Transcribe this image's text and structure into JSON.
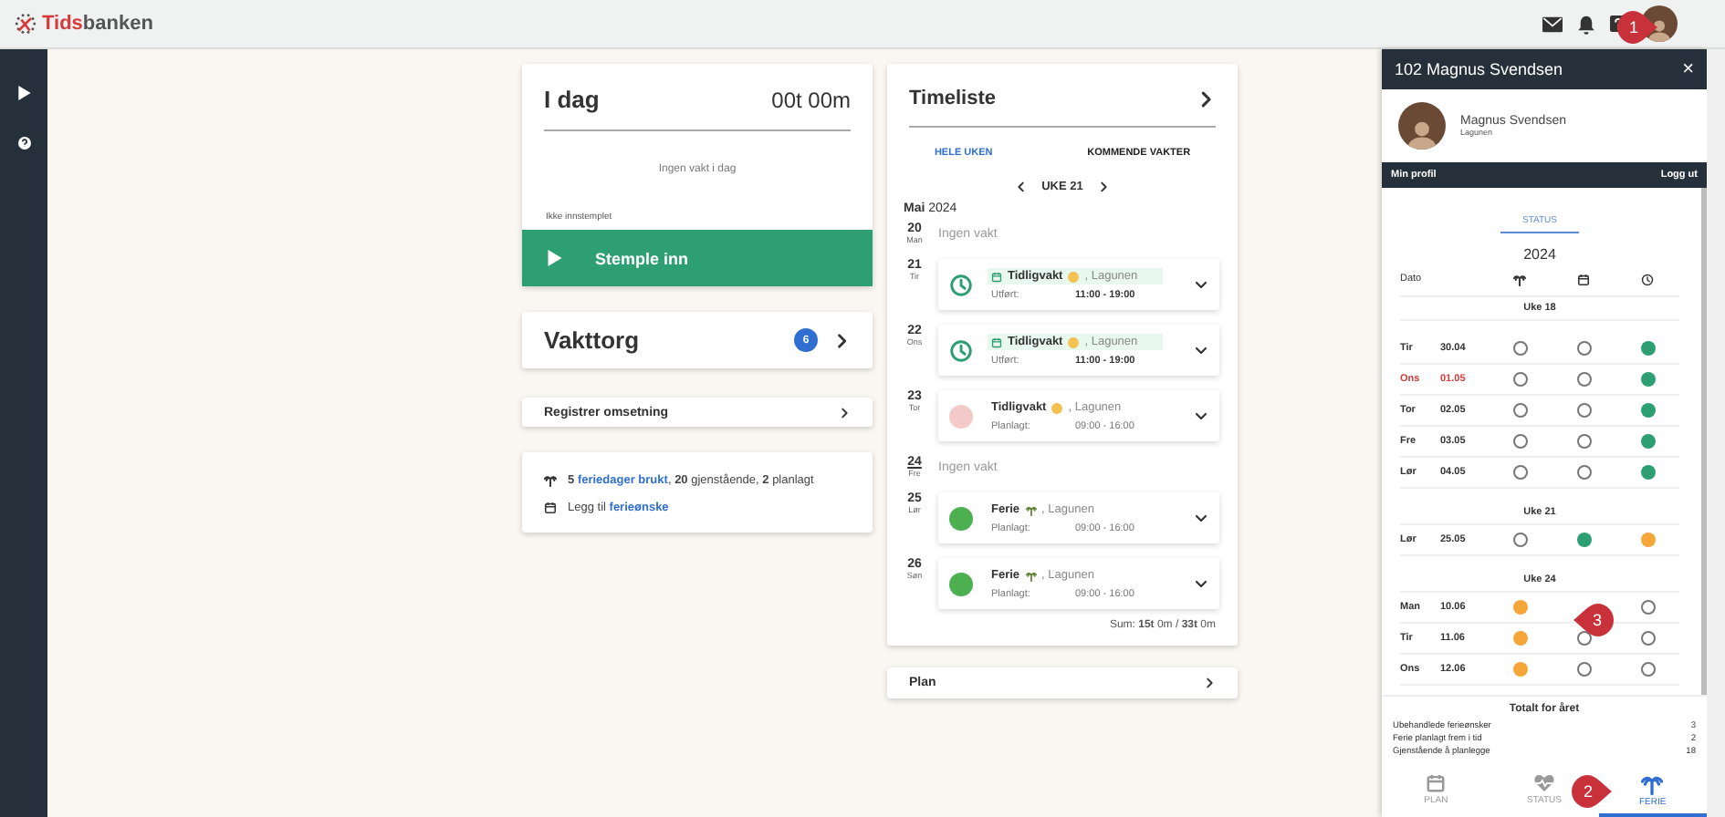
{
  "app": {
    "logo_first": "Tids",
    "logo_second": "banken"
  },
  "today": {
    "title": "I dag",
    "hours": "00t 00m",
    "message": "Ingen vakt i dag",
    "status": "Ikke innstemplet",
    "button": "Stemple inn"
  },
  "market": {
    "title": "Vakttorg",
    "count": "6"
  },
  "turnover": {
    "label": "Registrer omsetning"
  },
  "vacation_summary": {
    "lines": [
      {
        "kind": "palm",
        "lead": "**5**",
        "link": "feriedager brukt",
        "rest": ", **20** gjenstående, **2** planlagt"
      },
      {
        "kind": "calendar",
        "lead": "Legg til",
        "link": "ferieønske"
      }
    ]
  },
  "timesheet": {
    "title": "Timeliste",
    "tabs": [
      {
        "label": "HELE UKEN",
        "selected": true
      },
      {
        "label": "KOMMENDE VAKTER",
        "selected": false
      }
    ],
    "week": "UKE 21",
    "month": "Mai",
    "year": "2024",
    "days": [
      {
        "day": "20",
        "weekday": "Man",
        "today": false,
        "empty_text": "Ingen vakt"
      },
      {
        "day": "21",
        "weekday": "Tir",
        "today": false,
        "shift": {
          "kind": "logged",
          "title": "Tidligvakt",
          "place": ", Lagunen",
          "label": "Utført:",
          "time": "11:00 - 19:00"
        }
      },
      {
        "day": "22",
        "weekday": "Ons",
        "today": false,
        "shift": {
          "kind": "logged",
          "title": "Tidligvakt",
          "place": ", Lagunen",
          "label": "Utført:",
          "time": "11:00 - 19:00"
        }
      },
      {
        "day": "23",
        "weekday": "Tor",
        "today": false,
        "shift": {
          "kind": "pending",
          "title": "Tidligvakt",
          "place": ", Lagunen",
          "label": "Planlagt:",
          "time": "09:00 - 16:00"
        }
      },
      {
        "day": "24",
        "weekday": "Fre",
        "today": true,
        "empty_text": "Ingen vakt"
      },
      {
        "day": "25",
        "weekday": "Lør",
        "today": false,
        "shift": {
          "kind": "vacation",
          "title": "Ferie",
          "place": ", Lagunen",
          "label": "Planlagt:",
          "time": "09:00 - 16:00"
        }
      },
      {
        "day": "26",
        "weekday": "Søn",
        "today": false,
        "shift": {
          "kind": "vacation",
          "title": "Ferie",
          "place": ", Lagunen",
          "label": "Planlagt:",
          "time": "09:00 - 16:00"
        }
      }
    ],
    "sum": "Sum: **15t** 0m / **33t** 0m"
  },
  "plan": {
    "label": "Plan"
  },
  "panel": {
    "title": "102 Magnus Svendsen",
    "close": "×",
    "user_name": "Magnus Svendsen",
    "user_place": "Lagunen",
    "profile_link": "Min profil",
    "logout": "Logg ut",
    "tab": {
      "label": "STATUS",
      "selected": true
    },
    "year": "2024",
    "date_header": "Dato",
    "weeks": [
      {
        "label": "Uke 18",
        "days": [
          {
            "weekday": "Tir",
            "date": "30.04",
            "holiday": false,
            "marks": [
              {
                "filled": false
              },
              {
                "filled": false
              },
              {
                "filled": true,
                "color": "#2e9e73"
              }
            ]
          },
          {
            "weekday": "Ons",
            "date": "01.05",
            "holiday": true,
            "marks": [
              {
                "filled": false
              },
              {
                "filled": false
              },
              {
                "filled": true,
                "color": "#2e9e73"
              }
            ]
          },
          {
            "weekday": "Tor",
            "date": "02.05",
            "holiday": false,
            "marks": [
              {
                "filled": false
              },
              {
                "filled": false
              },
              {
                "filled": true,
                "color": "#2e9e73"
              }
            ]
          },
          {
            "weekday": "Fre",
            "date": "03.05",
            "holiday": false,
            "marks": [
              {
                "filled": false
              },
              {
                "filled": false
              },
              {
                "filled": true,
                "color": "#2e9e73"
              }
            ]
          },
          {
            "weekday": "Lør",
            "date": "04.05",
            "holiday": false,
            "marks": [
              {
                "filled": false
              },
              {
                "filled": false
              },
              {
                "filled": true,
                "color": "#2e9e73"
              }
            ]
          }
        ]
      },
      {
        "label": "Uke 21",
        "days": [
          {
            "weekday": "Lør",
            "date": "25.05",
            "holiday": false,
            "marks": [
              {
                "filled": false
              },
              {
                "filled": true,
                "color": "#2e9e73"
              },
              {
                "filled": true,
                "color": "#f5a638"
              }
            ]
          }
        ]
      },
      {
        "label": "Uke 24",
        "days": [
          {
            "weekday": "Man",
            "date": "10.06",
            "holiday": false,
            "marks": {
              "column_1": {
                "filled": true,
                "color": "#f5a638"
              },
              "column_3": {
                "filled": false
              }
            }
          },
          {
            "weekday": "Tir",
            "date": "11.06",
            "holiday": false,
            "marks": [
              {
                "filled": true,
                "color": "#f5a638"
              },
              {
                "filled": false
              },
              {
                "filled": false
              }
            ]
          },
          {
            "weekday": "Ons",
            "date": "12.06",
            "holiday": false,
            "marks": [
              {
                "filled": true,
                "color": "#f5a638"
              },
              {
                "filled": false
              },
              {
                "filled": false
              }
            ]
          }
        ]
      }
    ],
    "totals": {
      "title": "Totalt for året",
      "rows": [
        {
          "label": "Ubehandlede ferieønsker",
          "value": "3"
        },
        {
          "label": "Ferie planlagt frem i tid",
          "value": "2"
        },
        {
          "label": "Gjenstående å planlegge",
          "value": "18"
        }
      ]
    },
    "nav": [
      {
        "kind": "calendar",
        "label": "PLAN",
        "selected": false
      },
      {
        "kind": "heart",
        "label": "STATUS",
        "selected": false
      },
      {
        "kind": "palm",
        "label": "FERIE",
        "selected": true
      }
    ]
  },
  "callouts": [
    {
      "number": "1"
    },
    {
      "number": "2"
    },
    {
      "number": "3"
    }
  ]
}
